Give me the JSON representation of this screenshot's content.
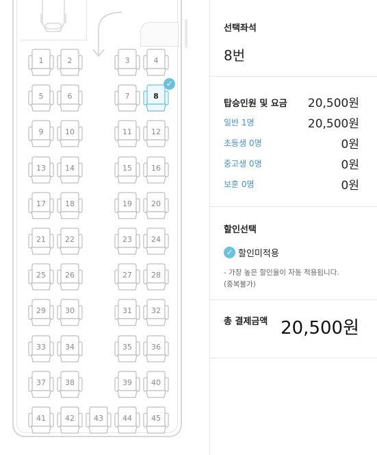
{
  "colors": {
    "accent": "#6ec1de",
    "link_blue": "#4a8fc2",
    "seat_stroke": "#bdbdbd",
    "selected_stroke": "#6ec1de"
  },
  "seats": [
    {
      "num": "1"
    },
    {
      "num": "2"
    },
    {
      "num": "3"
    },
    {
      "num": "4"
    },
    {
      "num": "5"
    },
    {
      "num": "6"
    },
    {
      "num": "7"
    },
    {
      "num": "8",
      "selected": true
    },
    {
      "num": "9"
    },
    {
      "num": "10"
    },
    {
      "num": "11"
    },
    {
      "num": "12"
    },
    {
      "num": "13"
    },
    {
      "num": "14"
    },
    {
      "num": "15"
    },
    {
      "num": "16"
    },
    {
      "num": "17"
    },
    {
      "num": "18"
    },
    {
      "num": "19"
    },
    {
      "num": "20"
    },
    {
      "num": "21"
    },
    {
      "num": "22"
    },
    {
      "num": "23"
    },
    {
      "num": "24"
    },
    {
      "num": "25"
    },
    {
      "num": "26"
    },
    {
      "num": "27"
    },
    {
      "num": "28"
    },
    {
      "num": "29"
    },
    {
      "num": "30"
    },
    {
      "num": "31"
    },
    {
      "num": "32"
    },
    {
      "num": "33"
    },
    {
      "num": "34"
    },
    {
      "num": "35"
    },
    {
      "num": "36"
    },
    {
      "num": "37"
    },
    {
      "num": "38"
    },
    {
      "num": "39"
    },
    {
      "num": "40"
    },
    {
      "num": "41"
    },
    {
      "num": "42"
    },
    {
      "num": "43"
    },
    {
      "num": "44"
    },
    {
      "num": "45"
    }
  ],
  "panel": {
    "selected_seat": {
      "title": "선택좌석",
      "value": "8번"
    },
    "fare": {
      "title": "탑승인원 및 요금",
      "total": "20,500원",
      "rows": [
        {
          "label": "일반 1명",
          "value": "20,500원"
        },
        {
          "label": "초등생 0명",
          "value": "0원"
        },
        {
          "label": "중고생 0명",
          "value": "0원"
        },
        {
          "label": "보훈 0명",
          "value": "0원"
        }
      ]
    },
    "discount": {
      "title": "할인선택",
      "option": "할인미적용",
      "check_icon": "✓",
      "note_line1": "- 가장 높은 할인율이 자동 적용됩니다.",
      "note_line2": "(중복불가)"
    },
    "total": {
      "label": "총 결제금액",
      "value": "20,500원"
    }
  }
}
